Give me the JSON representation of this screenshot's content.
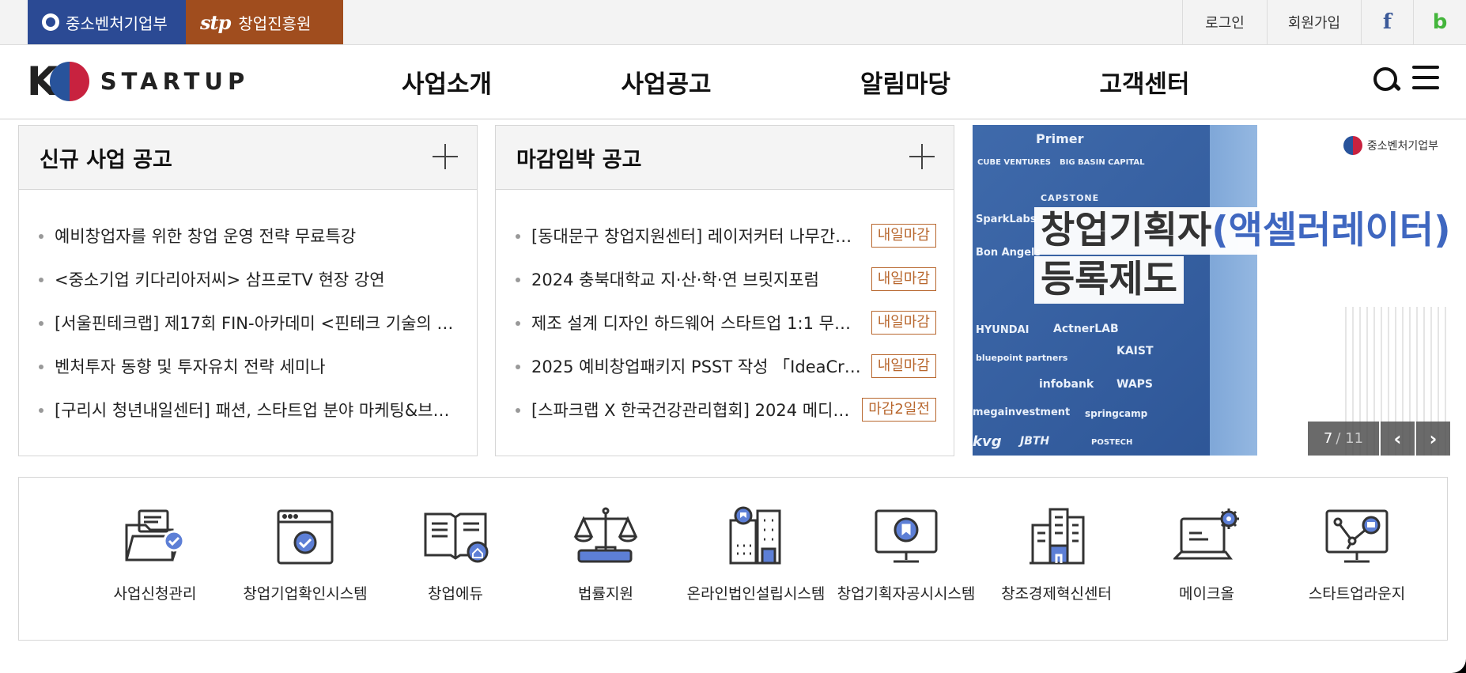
{
  "topbar": {
    "orgs": [
      {
        "label": "중소벤처기업부"
      },
      {
        "label": "창업진흥원",
        "logo_text": "stp"
      }
    ],
    "links": {
      "login": "로그인",
      "join": "회원가입",
      "facebook": "f",
      "blog": "b"
    }
  },
  "header": {
    "logo": {
      "k": "K",
      "text": "STARTUP"
    },
    "nav": [
      "사업소개",
      "사업공고",
      "알림마당",
      "고객센터"
    ]
  },
  "new_notices": {
    "title": "신규 사업 공고",
    "items": [
      "예비창업자를 위한 창업 운영 전략 무료특강",
      "<중소기업 키다리아저씨> 삼프로TV 현장 강연",
      "[서울핀테크랩] 제17회 FIN-아카데미 <핀테크 기술의 …",
      "벤처투자 동향 및 투자유치 전략 세미나",
      "[구리시 청년내일센터] 패션, 스타트업 분야 마케팅&브…"
    ]
  },
  "deadline_notices": {
    "title": "마감임박 공고",
    "items": [
      {
        "text": "[동대문구 창업지원센터] 레이저커터 나무간…",
        "badge": "내일마감"
      },
      {
        "text": "2024 충북대학교 지·산·학·연 브릿지포럼",
        "badge": "내일마감"
      },
      {
        "text": "제조 설계 디자인 하드웨어 스타트업 1:1 무…",
        "badge": "내일마감"
      },
      {
        "text": "2025 예비창업패키지 PSST 작성 「IdeaCr…",
        "badge": "내일마감"
      },
      {
        "text": "[스파크랩 X 한국건강관리협회] 2024 메디…",
        "badge": "마감2일전"
      }
    ]
  },
  "banner": {
    "title_prefix": "창업기획자",
    "title_accent": "(액셀러레이터)",
    "title_line2": "등록제도",
    "org": "중소벤처기업부",
    "logos": [
      "Primer",
      "CUBE VENTURES",
      "BIG BASIN CAPITAL",
      "CAPSTONE",
      "SparkLabs",
      "Bon Angels",
      "HYUNDAI",
      "ActnerLAB",
      "bluepoint partners",
      "KAIST",
      "infobank",
      "WAPS",
      "megainvestment",
      "springcamp",
      "JBTH",
      "POSTECH",
      "kvg"
    ],
    "pager": {
      "current": "7",
      "total": "/ 11",
      "prev": "‹",
      "next": "›"
    }
  },
  "services": [
    {
      "label": "사업신청관리",
      "icon": "folder-check-icon"
    },
    {
      "label": "창업기업확인시스템",
      "icon": "browser-check-icon"
    },
    {
      "label": "창업에듀",
      "icon": "book-home-icon"
    },
    {
      "label": "법률지원",
      "icon": "scales-icon"
    },
    {
      "label": "온라인법인설립시스템",
      "icon": "buildings-icon"
    },
    {
      "label": "창업기획자공시시스템",
      "icon": "monitor-bookmark-icon"
    },
    {
      "label": "창조경제혁신센터",
      "icon": "skyscraper-icon"
    },
    {
      "label": "메이크올",
      "icon": "laptop-gear-icon"
    },
    {
      "label": "스타트업라운지",
      "icon": "network-monitor-icon"
    }
  ],
  "colors": {
    "mss_blue": "#2b4a94",
    "kised_brown": "#a04d1e",
    "badge": "#b8672e",
    "icon_accent": "#5d7fd6"
  }
}
